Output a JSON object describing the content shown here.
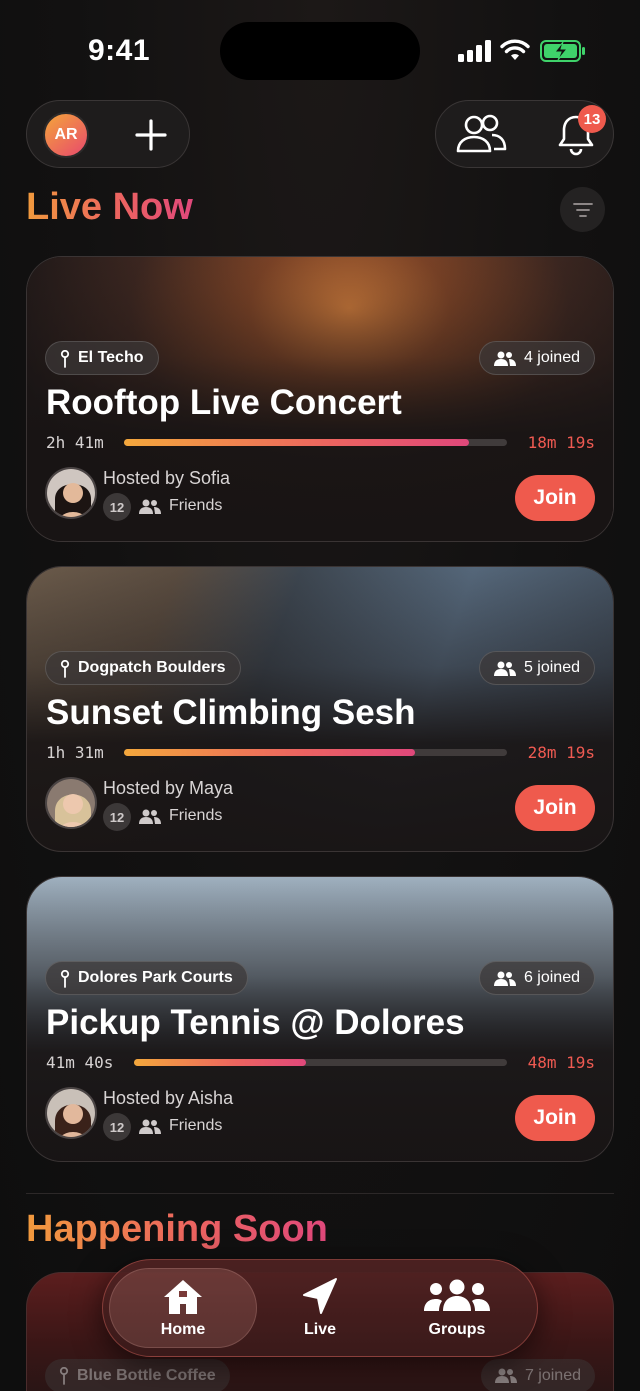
{
  "status_bar": {
    "time": "9:41"
  },
  "top_bar": {
    "avatar_initials": "AR",
    "notification_count": "13",
    "icons": [
      "plus-icon",
      "friends-icon",
      "bell-icon"
    ]
  },
  "live_now": {
    "title": "Live Now",
    "cards": [
      {
        "location": "El Techo",
        "joined": "4 joined",
        "title": "Rooftop Live Concert",
        "elapsed": "2h 41m",
        "remaining": "18m 19s",
        "progress": 0.9,
        "host": "Hosted by Sofia",
        "friend_count": "12",
        "friends_label": "Friends",
        "join_label": "Join"
      },
      {
        "location": "Dogpatch Boulders",
        "joined": "5 joined",
        "title": "Sunset Climbing Sesh",
        "elapsed": "1h 31m",
        "remaining": "28m 19s",
        "progress": 0.76,
        "host": "Hosted by Maya",
        "friend_count": "12",
        "friends_label": "Friends",
        "join_label": "Join"
      },
      {
        "location": "Dolores Park Courts",
        "joined": "6 joined",
        "title": "Pickup Tennis @ Dolores",
        "elapsed": "41m 40s",
        "remaining": "48m 19s",
        "progress": 0.46,
        "host": "Hosted by Aisha",
        "friend_count": "12",
        "friends_label": "Friends",
        "join_label": "Join"
      }
    ]
  },
  "happening_soon": {
    "title": "Happening Soon",
    "preview": {
      "location": "Blue Bottle Coffee",
      "joined": "7 joined"
    }
  },
  "tab_bar": {
    "tabs": [
      {
        "label": "Home",
        "icon": "home-icon",
        "active": true
      },
      {
        "label": "Live",
        "icon": "navigation-arrow-icon",
        "active": false
      },
      {
        "label": "Groups",
        "icon": "groups-icon",
        "active": false
      }
    ]
  },
  "colors": {
    "accent": "#ef5a4d",
    "gradient_start": "#f19a3d",
    "gradient_end": "#e0487b"
  }
}
